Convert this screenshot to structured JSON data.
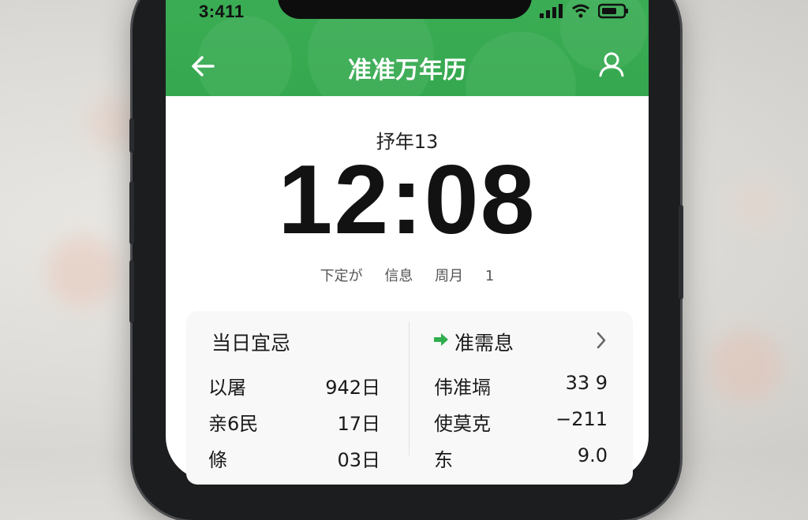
{
  "status_bar": {
    "time": "3:411",
    "signal_icon": "signal-bars-icon",
    "wifi_icon": "wifi-icon",
    "battery_icon": "battery-icon"
  },
  "header": {
    "title": "准准万年历",
    "back_icon": "arrow-left-icon",
    "user_icon": "user-profile-icon",
    "accent_color": "#3cae55"
  },
  "clock": {
    "date_label": "抒年13",
    "time": "12:08",
    "info": [
      "下定が",
      "信息",
      "周月",
      "1"
    ]
  },
  "left_card": {
    "title": "当日宜忌",
    "rows": [
      {
        "label": "以屠",
        "value": "942日"
      },
      {
        "label": "亲6民",
        "value": "17日"
      },
      {
        "label": "條",
        "value": "03日"
      }
    ]
  },
  "right_card": {
    "title": "准需息",
    "arrow_icon": "arrow-right-icon",
    "chevron_icon": "chevron-right-icon",
    "rows": [
      {
        "label": "伟准塥",
        "value": "33 9"
      },
      {
        "label": "使莫克",
        "value": "−211"
      },
      {
        "label": "东",
        "value": "9.0"
      }
    ]
  }
}
